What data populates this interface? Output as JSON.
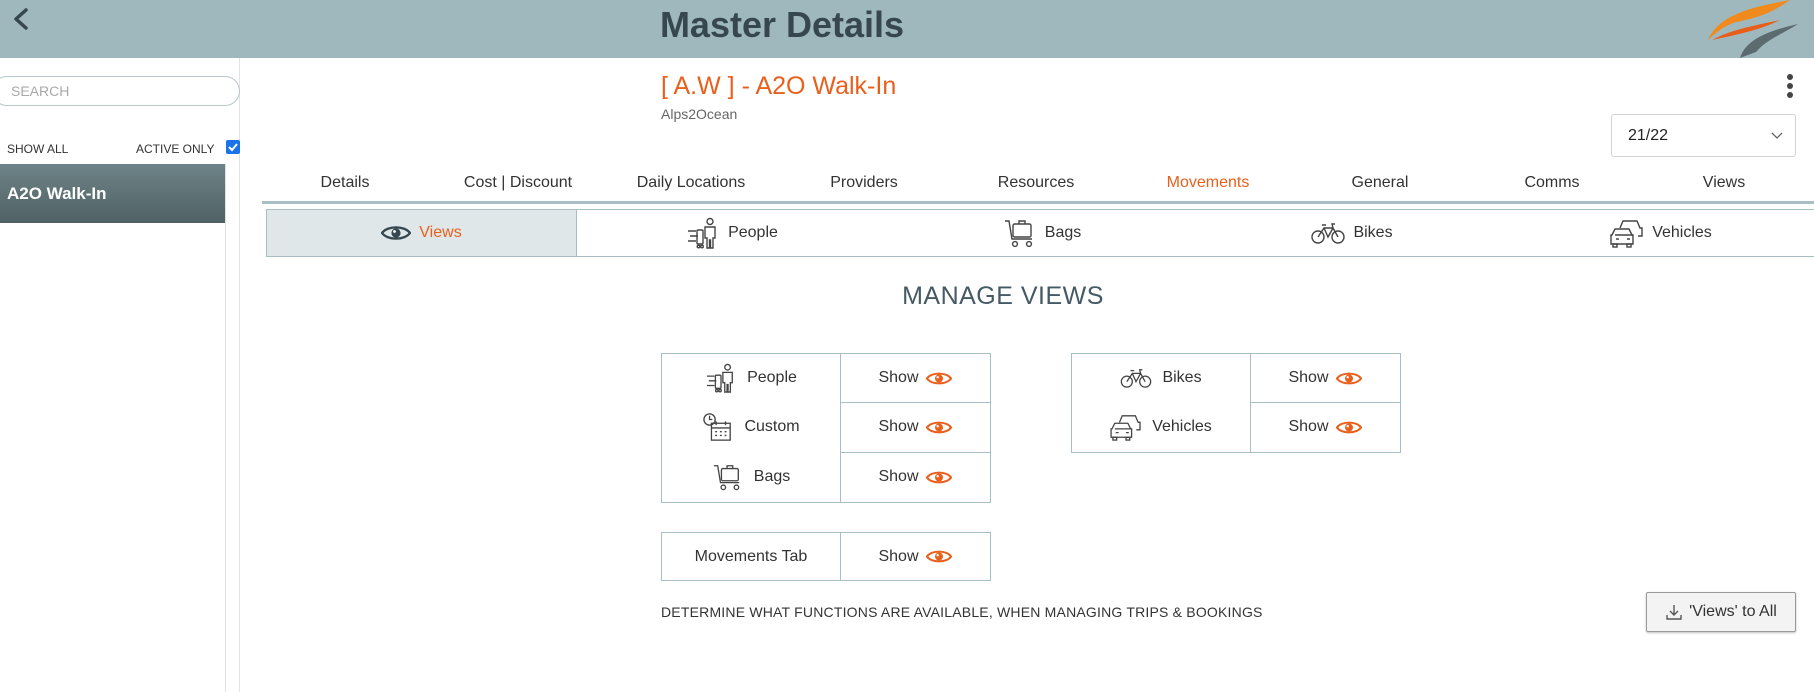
{
  "header": {
    "title": "Master Details"
  },
  "sidebar": {
    "search_placeholder": "SEARCH",
    "show_all": "SHOW ALL",
    "active_only": "ACTIVE ONLY",
    "items": [
      {
        "label": "A2O Walk-In"
      }
    ]
  },
  "record": {
    "title": "[ A.W ] - A2O Walk-In",
    "subtitle": "Alps2Ocean",
    "season": "21/22"
  },
  "main_tabs": [
    "Details",
    "Cost | Discount",
    "Daily Locations",
    "Providers",
    "Resources",
    "Movements",
    "General",
    "Comms",
    "Views"
  ],
  "active_main_tab": "Movements",
  "sub_tabs": [
    "Views",
    "People",
    "Bags",
    "Bikes",
    "Vehicles"
  ],
  "active_sub_tab": "Views",
  "section": {
    "title": "MANAGE VIEWS"
  },
  "views_left": [
    {
      "label": "People",
      "action": "Show"
    },
    {
      "label": "Custom",
      "action": "Show"
    },
    {
      "label": "Bags",
      "action": "Show"
    }
  ],
  "views_right": [
    {
      "label": "Bikes",
      "action": "Show"
    },
    {
      "label": "Vehicles",
      "action": "Show"
    }
  ],
  "views_tab": {
    "label": "Movements Tab",
    "action": "Show"
  },
  "footnote": "DETERMINE WHAT FUNCTIONS ARE AVAILABLE, WHEN MANAGING TRIPS & BOOKINGS",
  "apply_button": "'Views' to All",
  "colors": {
    "accent": "#e8601c",
    "header_bg": "#9fb8bd",
    "border": "#a7bec2"
  }
}
